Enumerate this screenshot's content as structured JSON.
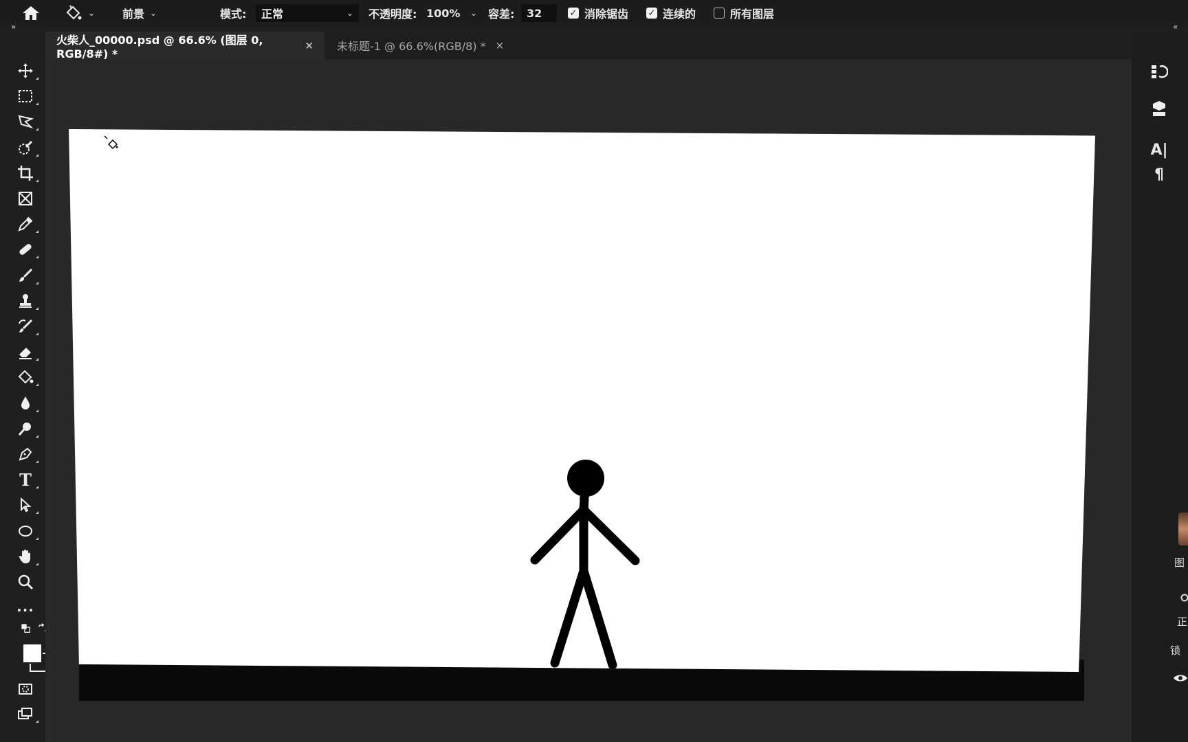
{
  "options_bar": {
    "home_icon": "home-icon",
    "tool_icon": "paint-bucket-icon",
    "fill_source": "前景",
    "mode_label": "模式:",
    "mode_value": "正常",
    "opacity_label": "不透明度:",
    "opacity_value": "100%",
    "tolerance_label": "容差:",
    "tolerance_value": "32",
    "antialias_label": "消除锯齿",
    "antialias_checked": true,
    "contiguous_label": "连续的",
    "contiguous_checked": true,
    "all_layers_label": "所有图层",
    "all_layers_checked": false
  },
  "tabs": [
    {
      "label": "火柴人_00000.psd @ 66.6% (图层 0, RGB/8#) *",
      "active": true,
      "close": "×"
    },
    {
      "label": "未标题-1 @ 66.6%(RGB/8) *",
      "active": false,
      "close": "×"
    }
  ],
  "panel_toggles": {
    "left": "»",
    "right": "«"
  },
  "toolbar": {
    "tools": [
      "move-icon",
      "marquee-icon",
      "lasso-icon",
      "quick-select-icon",
      "crop-icon",
      "frame-icon",
      "eyedropper-icon",
      "healing-icon",
      "brush-icon",
      "stamp-icon",
      "history-brush-icon",
      "eraser-icon",
      "paint-bucket-icon",
      "blur-icon",
      "dodge-icon",
      "pen-icon",
      "type-icon",
      "path-select-icon",
      "ellipse-icon",
      "hand-icon",
      "zoom-icon",
      "more-icon"
    ],
    "type_glyph": "T",
    "more_glyph": "..."
  },
  "right_panel": {
    "icons": [
      "history-icon",
      "3d-icon",
      "character-icon",
      "paragraph-icon",
      "eye-icon"
    ],
    "char_glyph": "A|",
    "para_glyph": "¶",
    "partial_labels": [
      "图",
      "正",
      "锁"
    ]
  },
  "colors": {
    "canvas": "#ffffff",
    "stick_figure": "#000000",
    "foreground": "#ffffff",
    "background": "#1f1f1f"
  }
}
